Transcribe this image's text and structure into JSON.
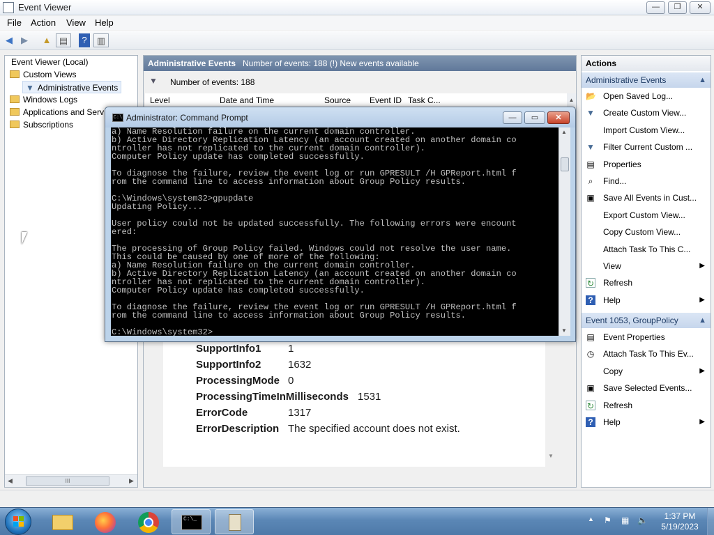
{
  "window": {
    "title": "Event Viewer",
    "min_btn": "—",
    "max_btn": "❐",
    "close_btn": "✕"
  },
  "menu": [
    "File",
    "Action",
    "View",
    "Help"
  ],
  "tree": {
    "root": "Event Viewer (Local)",
    "custom_views": "Custom Views",
    "administrative_events": "Administrative Events",
    "windows_logs": "Windows Logs",
    "applications": "Applications and Serv",
    "subscriptions": "Subscriptions",
    "scroll_grip": "III"
  },
  "center": {
    "header_title": "Administrative Events",
    "header_info": "Number of events: 188 (!) New events available",
    "filter_text": "Number of events: 188",
    "columns": [
      "Level",
      "Date and Time",
      "Source",
      "Event ID",
      "Task C..."
    ],
    "properties": [
      {
        "key": "SupportInfo1",
        "value": "1"
      },
      {
        "key": "SupportInfo2",
        "value": "1632"
      },
      {
        "key": "ProcessingMode",
        "value": "0"
      },
      {
        "key": "ProcessingTimeInMilliseconds",
        "value": "1531"
      },
      {
        "key": "ErrorCode",
        "value": "1317"
      },
      {
        "key": "ErrorDescription",
        "value": "The specified account does not exist."
      }
    ]
  },
  "actions": {
    "title": "Actions",
    "section1": "Administrative Events",
    "items1": [
      {
        "icon": "open-folder-icon",
        "glyph": "📂",
        "label": "Open Saved Log...",
        "arrow": ""
      },
      {
        "icon": "filter-icon",
        "glyph": "▼",
        "label": "Create Custom View...",
        "arrow": ""
      },
      {
        "icon": "blank-icon",
        "glyph": "",
        "label": "Import Custom View...",
        "arrow": ""
      },
      {
        "icon": "filter-icon",
        "glyph": "▼",
        "label": "Filter Current Custom ...",
        "arrow": ""
      },
      {
        "icon": "properties-icon",
        "glyph": "▤",
        "label": "Properties",
        "arrow": ""
      },
      {
        "icon": "binoculars-icon",
        "glyph": "⌕",
        "label": "Find...",
        "arrow": ""
      },
      {
        "icon": "save-icon",
        "glyph": "▣",
        "label": "Save All Events in Cust...",
        "arrow": ""
      },
      {
        "icon": "blank-icon",
        "glyph": "",
        "label": "Export Custom View...",
        "arrow": ""
      },
      {
        "icon": "blank-icon",
        "glyph": "",
        "label": "Copy Custom View...",
        "arrow": ""
      },
      {
        "icon": "blank-icon",
        "glyph": "",
        "label": "Attach Task To This C...",
        "arrow": ""
      },
      {
        "icon": "blank-icon",
        "glyph": "",
        "label": "View",
        "arrow": "▶"
      },
      {
        "icon": "refresh-icon",
        "glyph": "↻",
        "label": "Refresh",
        "arrow": ""
      },
      {
        "icon": "help-icon",
        "glyph": "?",
        "label": "Help",
        "arrow": "▶"
      }
    ],
    "section2": "Event 1053, GroupPolicy",
    "items2": [
      {
        "icon": "event-properties-icon",
        "glyph": "▤",
        "label": "Event Properties",
        "arrow": ""
      },
      {
        "icon": "task-icon",
        "glyph": "◷",
        "label": "Attach Task To This Ev...",
        "arrow": ""
      },
      {
        "icon": "blank-icon",
        "glyph": "",
        "label": "Copy",
        "arrow": "▶"
      },
      {
        "icon": "save-icon",
        "glyph": "▣",
        "label": "Save Selected Events...",
        "arrow": ""
      },
      {
        "icon": "refresh-icon",
        "glyph": "↻",
        "label": "Refresh",
        "arrow": ""
      },
      {
        "icon": "help-icon",
        "glyph": "?",
        "label": "Help",
        "arrow": "▶"
      }
    ]
  },
  "cmd": {
    "title": "Administrator: Command Prompt",
    "icon_text": "C:\\",
    "lines": [
      "a) Name Resolution failure on the current domain controller.",
      "b) Active Directory Replication Latency (an account created on another domain co",
      "ntroller has not replicated to the current domain controller).",
      "Computer Policy update has completed successfully.",
      "",
      "To diagnose the failure, review the event log or run GPRESULT /H GPReport.html f",
      "rom the command line to access information about Group Policy results.",
      "",
      "C:\\Windows\\system32>gpupdate",
      "Updating Policy...",
      "",
      "User policy could not be updated successfully. The following errors were encount",
      "ered:",
      "",
      "The processing of Group Policy failed. Windows could not resolve the user name.",
      "This could be caused by one of more of the following:",
      "a) Name Resolution failure on the current domain controller.",
      "b) Active Directory Replication Latency (an account created on another domain co",
      "ntroller has not replicated to the current domain controller).",
      "Computer Policy update has completed successfully.",
      "",
      "To diagnose the failure, review the event log or run GPRESULT /H GPReport.html f",
      "rom the command line to access information about Group Policy results.",
      "",
      "C:\\Windows\\system32>"
    ]
  },
  "taskbar": {
    "clock_time": "1:37 PM",
    "clock_date": "5/19/2023",
    "show_hidden": "▲",
    "cmd_text": "C:\\_"
  },
  "colors": {
    "accent": "#60789a",
    "console_bg": "#000000",
    "console_fg": "#c0c0c0",
    "taskbar": "#5b87b6"
  }
}
